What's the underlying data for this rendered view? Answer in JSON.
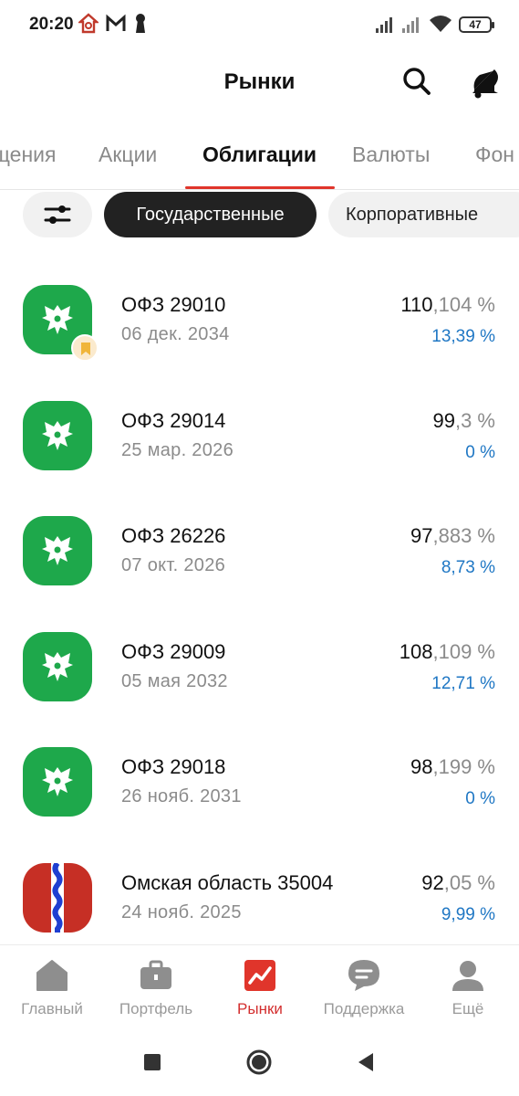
{
  "status_bar": {
    "time": "20:20",
    "battery": "47"
  },
  "header": {
    "title": "Рынки"
  },
  "tabs": [
    {
      "label": "щения"
    },
    {
      "label": "Акции"
    },
    {
      "label": "Облигации"
    },
    {
      "label": "Валюты"
    },
    {
      "label": "Фон"
    }
  ],
  "chips": {
    "government": "Государственные",
    "corporate": "Корпоративные"
  },
  "bonds": [
    {
      "name": "ОФЗ 29010",
      "date": "06 дек. 2034",
      "price_int": "110",
      "price_frac": ",104 %",
      "yield": "13,39 %",
      "favorite": true
    },
    {
      "name": "ОФЗ 29014",
      "date": "25 мар. 2026",
      "price_int": "99",
      "price_frac": ",3 %",
      "yield": "0 %"
    },
    {
      "name": "ОФЗ 26226",
      "date": "07 окт. 2026",
      "price_int": "97",
      "price_frac": ",883 %",
      "yield": "8,73 %"
    },
    {
      "name": "ОФЗ 29009",
      "date": "05 мая 2032",
      "price_int": "108",
      "price_frac": ",109 %",
      "yield": "12,71 %"
    },
    {
      "name": "ОФЗ 29018",
      "date": "26 нояб. 2031",
      "price_int": "98",
      "price_frac": ",199 %",
      "yield": "0 %"
    },
    {
      "name": "Омская область 35004",
      "date": "24 нояб. 2025",
      "price_int": "92",
      "price_frac": ",05 %",
      "yield": "9,99 %"
    }
  ],
  "bottom_nav": [
    {
      "label": "Главный"
    },
    {
      "label": "Портфель"
    },
    {
      "label": "Рынки"
    },
    {
      "label": "Поддержка"
    },
    {
      "label": "Ещё"
    }
  ],
  "colors": {
    "accent": "#e0352b",
    "bond_green": "#1ea84b",
    "yield_blue": "#1f77c4",
    "chip_active": "#222222",
    "omsk_red": "#c62f25",
    "omsk_blue": "#1f3fd1"
  }
}
